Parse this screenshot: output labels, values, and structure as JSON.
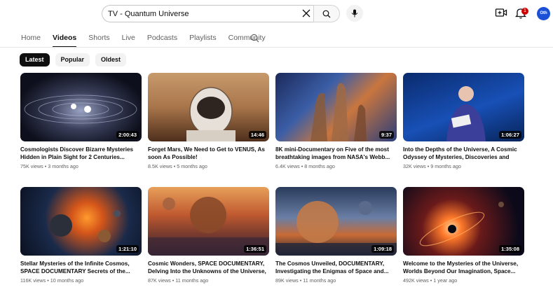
{
  "search": {
    "value": "TV - Quantum Universe"
  },
  "header": {
    "notification_count": "1",
    "avatar_label": "Oth"
  },
  "tabs": [
    {
      "label": "Home",
      "active": false
    },
    {
      "label": "Videos",
      "active": true
    },
    {
      "label": "Shorts",
      "active": false
    },
    {
      "label": "Live",
      "active": false
    },
    {
      "label": "Podcasts",
      "active": false
    },
    {
      "label": "Playlists",
      "active": false
    },
    {
      "label": "Community",
      "active": false
    }
  ],
  "chips": [
    {
      "label": "Latest",
      "active": true
    },
    {
      "label": "Popular",
      "active": false
    },
    {
      "label": "Oldest",
      "active": false
    }
  ],
  "videos": [
    {
      "title": "Cosmologists Discover Bizarre Mysteries Hidden in Plain Sight for 2 Centuries...",
      "views": "75K views",
      "age": "3 months ago",
      "duration": "2:00:43"
    },
    {
      "title": "Forget Mars, We Need to Get to VENUS, As soon As Possible!",
      "views": "8.5K views",
      "age": "5 months ago",
      "duration": "14:46"
    },
    {
      "title": "8K mini-Documentary on Five of the most breathtaking images from NASA's Webb...",
      "views": "6.4K views",
      "age": "8 months ago",
      "duration": "9:37"
    },
    {
      "title": "Into the Depths of the Universe, A Cosmic Odyssey of Mysteries, Discoveries and Min...",
      "views": "32K views",
      "age": "9 months ago",
      "duration": "1:06:27"
    },
    {
      "title": "Stellar Mysteries of the Infinite Cosmos, SPACE DOCUMENTARY Secrets of the...",
      "views": "116K views",
      "age": "10 months ago",
      "duration": "1:21:10"
    },
    {
      "title": "Cosmic Wonders, SPACE DOCUMENTARY, Delving Into the Unknowns of the Universe, ...",
      "views": "87K views",
      "age": "11 months ago",
      "duration": "1:36:51"
    },
    {
      "title": "The Cosmos Unveiled, DOCUMENTARY, Investigating the Enigmas of Space and...",
      "views": "89K views",
      "age": "11 months ago",
      "duration": "1:09:18"
    },
    {
      "title": "Welcome to the Mysteries of the Universe, Worlds Beyond Our Imagination, Space...",
      "views": "492K views",
      "age": "1 year ago",
      "duration": "1:35:08"
    }
  ]
}
